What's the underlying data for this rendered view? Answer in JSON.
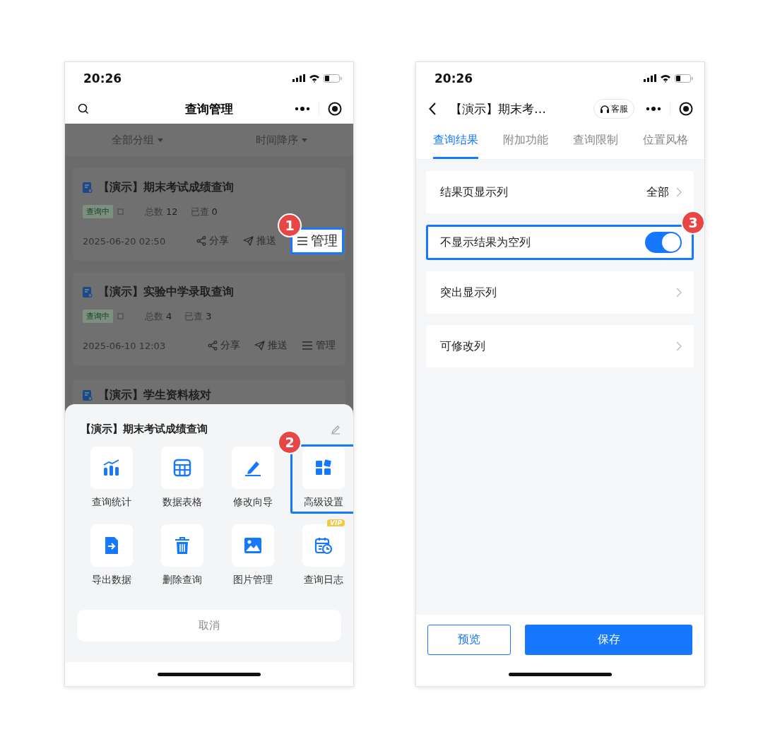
{
  "left_phone": {
    "status_bar": {
      "time": "20:26"
    },
    "nav_bar": {
      "title": "查询管理"
    },
    "filters": [
      {
        "label": "全部分组"
      },
      {
        "label": "时间降序"
      }
    ],
    "queries": [
      {
        "title": "【演示】期末考试成绩查询",
        "status": "查询中",
        "total_label": "总数",
        "total": "12",
        "checked_label": "已查",
        "checked": "0",
        "date": "2025-06-20 02:50",
        "actions": [
          {
            "label": "分享",
            "highlighted": false
          },
          {
            "label": "推送",
            "highlighted": false
          },
          {
            "label": "管理",
            "highlighted": true,
            "badge": "1"
          }
        ]
      },
      {
        "title": "【演示】实验中学录取查询",
        "status": "查询中",
        "total_label": "总数",
        "total": "4",
        "checked_label": "已查",
        "checked": "3",
        "date": "2025-06-10 12:03",
        "actions": [
          {
            "label": "分享",
            "highlighted": false
          },
          {
            "label": "推送",
            "highlighted": false
          },
          {
            "label": "管理",
            "highlighted": false
          }
        ]
      },
      {
        "title": "【演示】学生资料核对"
      }
    ],
    "action_sheet": {
      "title": "【演示】期末考试成绩查询",
      "items": [
        {
          "label": "查询统计",
          "highlighted": false
        },
        {
          "label": "数据表格",
          "highlighted": false
        },
        {
          "label": "修改向导",
          "highlighted": false
        },
        {
          "label": "高级设置",
          "highlighted": true,
          "badge": "2"
        },
        {
          "label": "导出数据",
          "highlighted": false
        },
        {
          "label": "删除查询",
          "highlighted": false
        },
        {
          "label": "图片管理",
          "highlighted": false
        },
        {
          "label": "查询日志",
          "highlighted": false,
          "tag": "VIP"
        }
      ],
      "cancel": "取消"
    }
  },
  "right_phone": {
    "status_bar": {
      "time": "20:26"
    },
    "nav_bar": {
      "title": "【演示】期末考…",
      "service": "客服"
    },
    "tabs": [
      {
        "label": "查询结果",
        "selected": true
      },
      {
        "label": "附加功能",
        "selected": false
      },
      {
        "label": "查询限制",
        "selected": false
      },
      {
        "label": "位置风格",
        "selected": false
      }
    ],
    "settings": [
      {
        "kind": "link",
        "label": "结果页显示列",
        "value": "全部",
        "highlighted": false
      },
      {
        "kind": "toggle",
        "label": "不显示结果为空列",
        "on": true,
        "highlighted": true,
        "badge": "3"
      },
      {
        "kind": "link",
        "label": "突出显示列",
        "highlighted": false
      },
      {
        "kind": "link",
        "label": "可修改列",
        "highlighted": false
      }
    ],
    "buttons": [
      {
        "label": "预览",
        "kind": "secondary"
      },
      {
        "label": "保存",
        "kind": "primary"
      }
    ]
  }
}
